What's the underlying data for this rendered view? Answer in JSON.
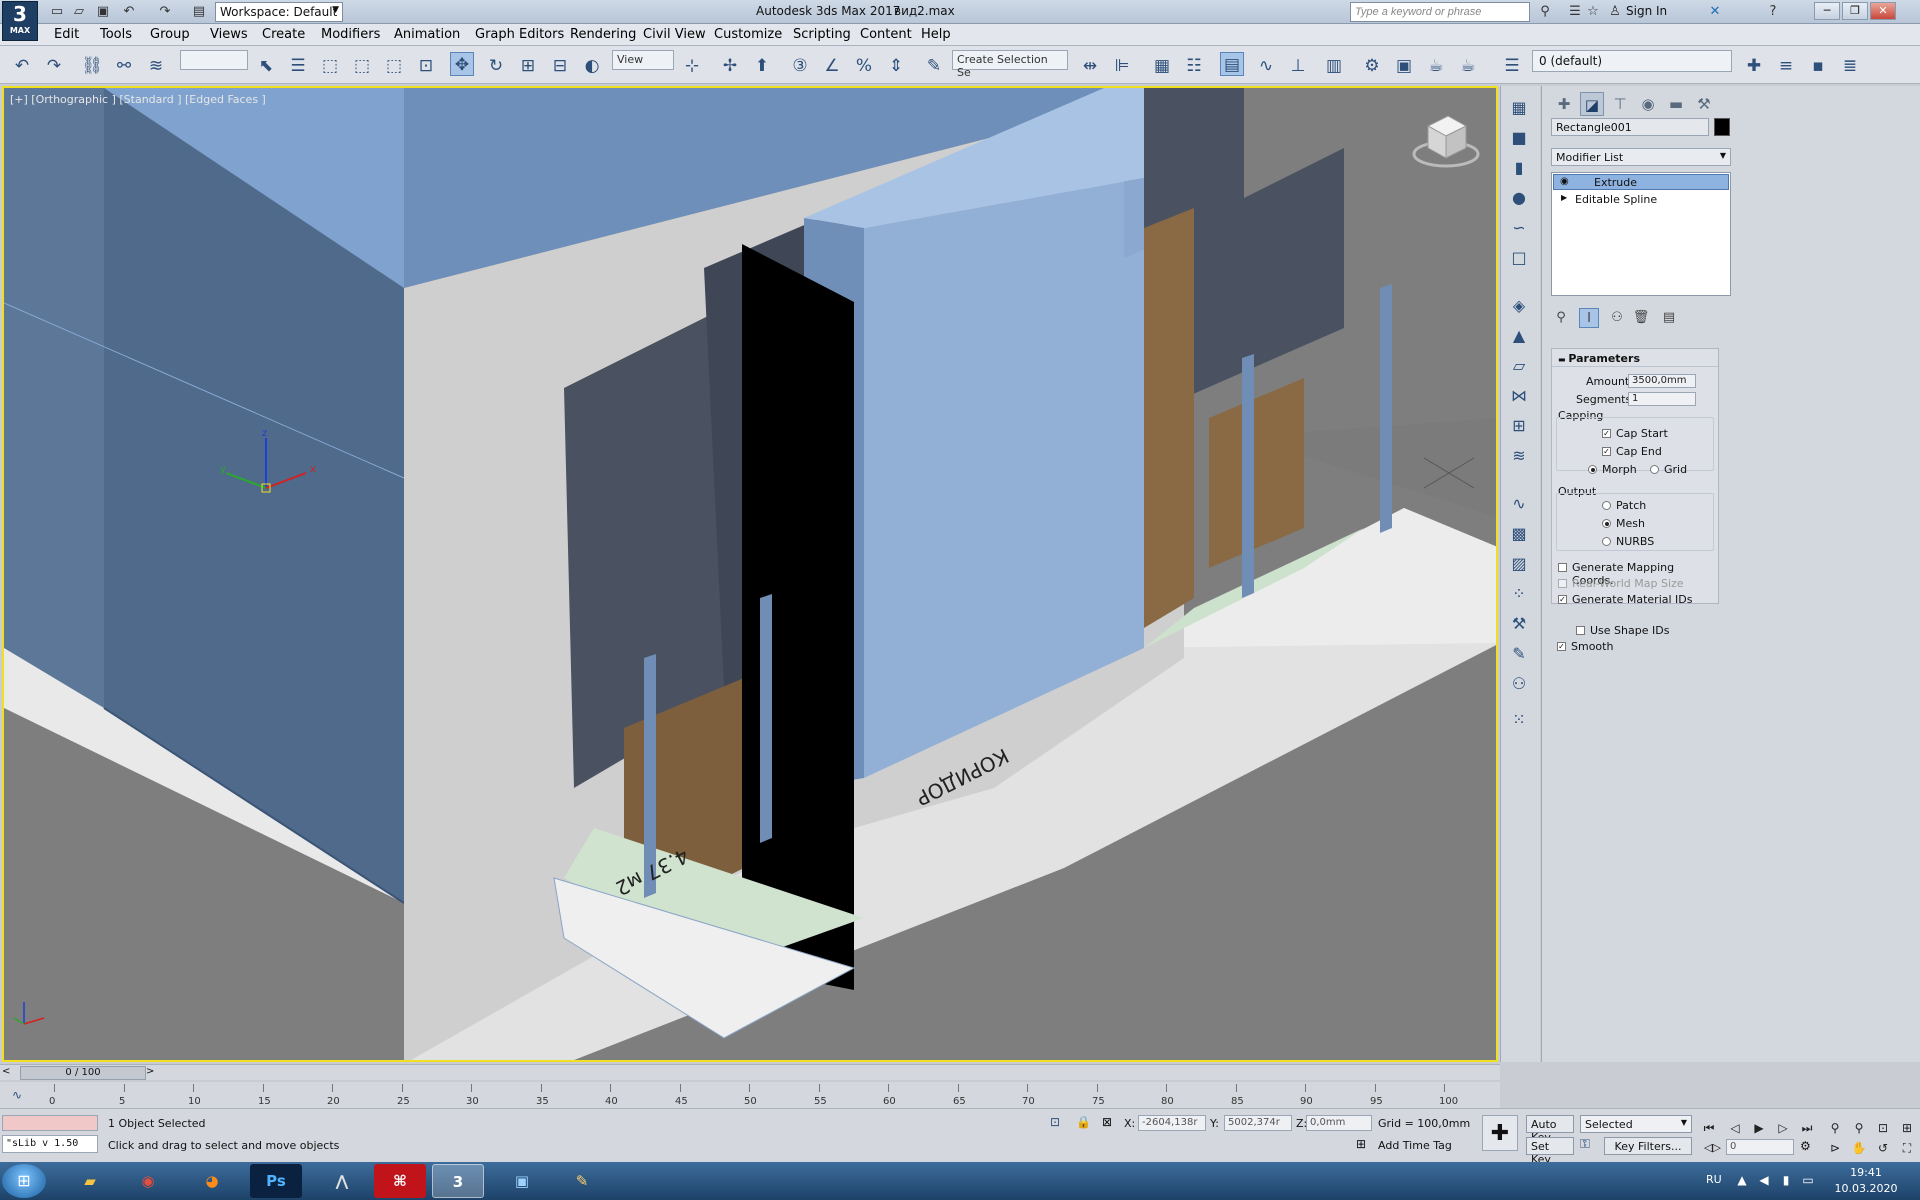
{
  "title_bar": {
    "app_title": "Autodesk 3ds Max 2017",
    "file_name": "вид2.max",
    "workspace_label": "Workspace: Default",
    "search_placeholder": "Type a keyword or phrase",
    "sign_in": "Sign In",
    "logo_top": "3",
    "logo_bottom": "MAX"
  },
  "menu": [
    "Edit",
    "Tools",
    "Group",
    "Views",
    "Create",
    "Modifiers",
    "Animation",
    "Graph Editors",
    "Rendering",
    "Civil View",
    "Customize",
    "Scripting",
    "Content",
    "Help"
  ],
  "toolbar": {
    "ref_coord": "View",
    "selection_set": "Create Selection Se",
    "layer": "0 (default)"
  },
  "viewport": {
    "label": "[+] [Orthographic ] [Standard ] [Edged Faces ]",
    "scene_texts": {
      "room_label": "КОРИДОР",
      "area_label": "4.37 м2"
    }
  },
  "command_panel": {
    "object_name": "Rectangle001",
    "modifier_list": "Modifier List",
    "stack": [
      "Extrude",
      "Editable Spline"
    ],
    "rollout_title": "Parameters",
    "amount_label": "Amount:",
    "amount_value": "3500,0mm",
    "segments_label": "Segments:",
    "segments_value": "1",
    "capping_label": "Capping",
    "cap_start": "Cap Start",
    "cap_end": "Cap End",
    "morph": "Morph",
    "grid": "Grid",
    "output_label": "Output",
    "patch": "Patch",
    "mesh": "Mesh",
    "nurbs": "NURBS",
    "gen_mapping": "Generate Mapping Coords.",
    "real_world": "Real-World Map Size",
    "gen_material": "Generate Material IDs",
    "use_shape": "Use Shape IDs",
    "smooth": "Smooth"
  },
  "timeline": {
    "frame_display": "0 / 100",
    "ticks": [
      "0",
      "5",
      "10",
      "15",
      "20",
      "25",
      "30",
      "35",
      "40",
      "45",
      "50",
      "55",
      "60",
      "65",
      "70",
      "75",
      "80",
      "85",
      "90",
      "95",
      "100"
    ]
  },
  "status": {
    "selected_count": "1 Object Selected",
    "prompt": "Click and drag to select and move objects",
    "maxscript": "\"sLib v 1.50",
    "x_label": "X:",
    "x_value": "-2604,138r",
    "y_label": "Y:",
    "y_value": "5002,374r",
    "z_label": "Z:",
    "z_value": "0,0mm",
    "grid": "Grid = 100,0mm",
    "add_time_tag": "Add Time Tag",
    "auto_key": "Auto Key",
    "set_key": "Set Key",
    "selected_dd": "Selected",
    "key_filters": "Key Filters...",
    "frame_field": "0"
  },
  "taskbar": {
    "lang": "RU",
    "time": "19:41",
    "date": "10.03.2020"
  }
}
